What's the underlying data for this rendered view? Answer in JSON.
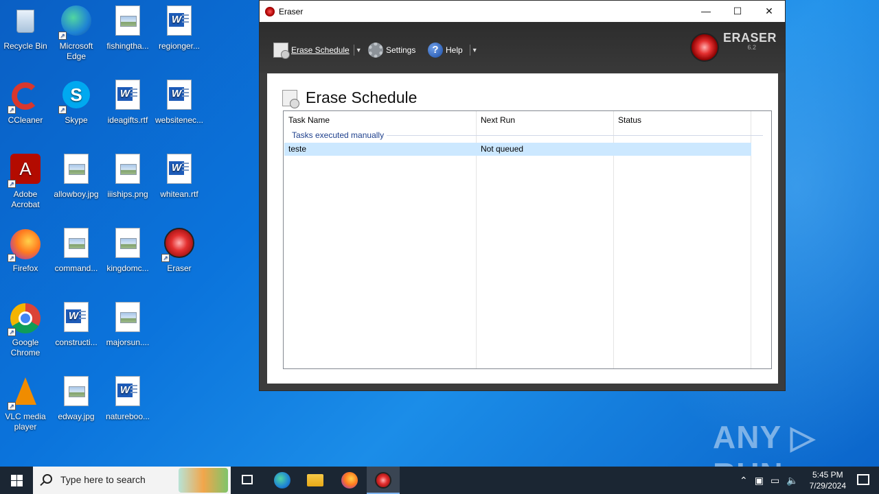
{
  "desktop": {
    "icons": [
      {
        "label": "Recycle Bin",
        "icon": "recycle-bin-icon"
      },
      {
        "label": "Microsoft Edge",
        "icon": "edge-icon"
      },
      {
        "label": "fishingtha...",
        "icon": "image-file-icon"
      },
      {
        "label": "regionger...",
        "icon": "word-file-icon"
      },
      {
        "label": "CCleaner",
        "icon": "ccleaner-icon"
      },
      {
        "label": "Skype",
        "icon": "skype-icon"
      },
      {
        "label": "ideagifts.rtf",
        "icon": "word-file-icon"
      },
      {
        "label": "websitenec...",
        "icon": "word-file-icon"
      },
      {
        "label": "Adobe Acrobat",
        "icon": "acrobat-icon"
      },
      {
        "label": "allowboy.jpg",
        "icon": "image-file-icon"
      },
      {
        "label": "iiiships.png",
        "icon": "image-file-icon"
      },
      {
        "label": "whitean.rtf",
        "icon": "word-file-icon"
      },
      {
        "label": "Firefox",
        "icon": "firefox-icon"
      },
      {
        "label": "command...",
        "icon": "image-file-icon"
      },
      {
        "label": "kingdomc...",
        "icon": "image-file-icon"
      },
      {
        "label": "Eraser",
        "icon": "eraser-icon"
      },
      {
        "label": "Google Chrome",
        "icon": "chrome-icon"
      },
      {
        "label": "constructi...",
        "icon": "word-file-icon"
      },
      {
        "label": "majorsun....",
        "icon": "image-file-icon"
      },
      {
        "label": "VLC media player",
        "icon": "vlc-icon"
      },
      {
        "label": "edway.jpg",
        "icon": "image-file-icon"
      },
      {
        "label": "natureboo...",
        "icon": "word-file-icon"
      }
    ]
  },
  "window": {
    "title": "Eraser",
    "controls": {
      "minimize": "—",
      "maximize": "☐",
      "close": "✕"
    },
    "toolbar": {
      "erase_schedule": "Erase Schedule",
      "settings": "Settings",
      "help": "Help",
      "dropdown_caret": "▼"
    },
    "brand": {
      "name": "ERASER",
      "version": "6.2"
    },
    "page_title": "Erase Schedule",
    "grid": {
      "columns": [
        "Task Name",
        "Next Run",
        "Status"
      ],
      "group_label": "Tasks executed manually",
      "rows": [
        {
          "task_name": "teste",
          "next_run": "Not queued",
          "status": ""
        }
      ]
    }
  },
  "watermark": "ANY ▷ RUN",
  "taskbar": {
    "search_placeholder": "Type here to search",
    "tray": {
      "chevron": "⌃",
      "time": "5:45 PM",
      "date": "7/29/2024"
    }
  },
  "colors": {
    "desktop_accent": "#0b74dc",
    "selected_row": "#cce8ff",
    "taskbar": "#1b2633",
    "eraser_red": "#e43030"
  }
}
